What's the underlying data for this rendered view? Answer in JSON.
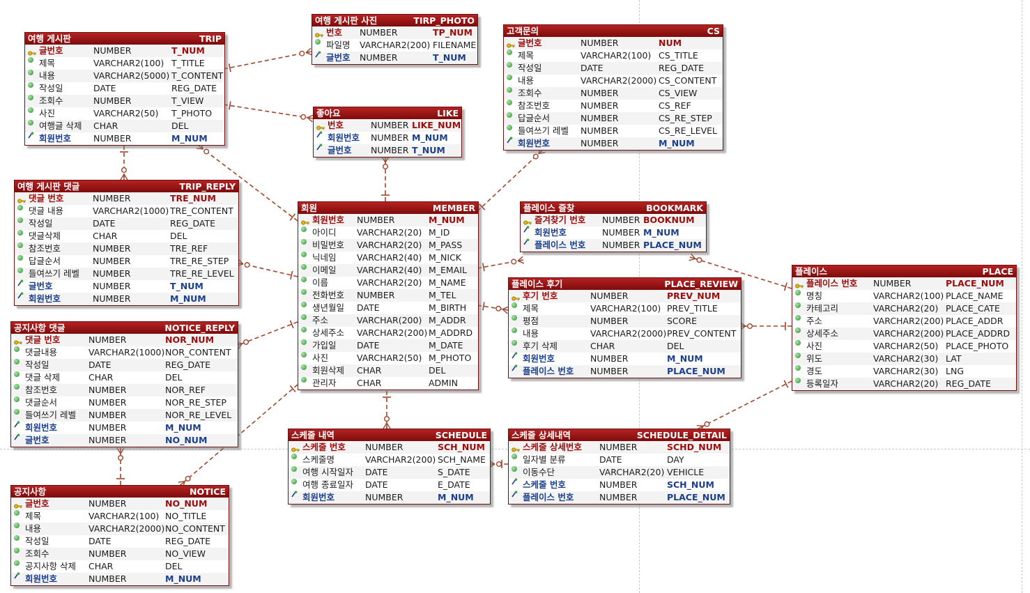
{
  "tables": [
    {
      "id": "trip",
      "title": "여행 게시판",
      "code": "TRIP",
      "rows": [
        {
          "kind": "pk",
          "name": "글번호",
          "type": "NUMBER",
          "col": "T_NUM"
        },
        {
          "kind": "col",
          "name": "제목",
          "type": "VARCHAR2(100)",
          "col": "T_TITLE"
        },
        {
          "kind": "col",
          "name": "내용",
          "type": "VARCHAR2(5000)",
          "col": "T_CONTENT"
        },
        {
          "kind": "col",
          "name": "작성일",
          "type": "DATE",
          "col": "REG_DATE"
        },
        {
          "kind": "col",
          "name": "조회수",
          "type": "NUMBER",
          "col": "T_VIEW"
        },
        {
          "kind": "col",
          "name": "사진",
          "type": "VARCHAR2(50)",
          "col": "T_PHOTO"
        },
        {
          "kind": "col",
          "name": "여행글 삭제",
          "type": "CHAR",
          "col": "DEL"
        },
        {
          "kind": "fk",
          "name": "회원번호",
          "type": "NUMBER",
          "col": "M_NUM"
        }
      ]
    },
    {
      "id": "trip_photo",
      "title": "여행 게시판 사진",
      "code": "TIRP_PHOTO",
      "rows": [
        {
          "kind": "pk",
          "name": "번호",
          "type": "NUMBER",
          "col": "TP_NUM"
        },
        {
          "kind": "col",
          "name": "파일명",
          "type": "VARCHAR2(200)",
          "col": "FILENAME"
        },
        {
          "kind": "fk",
          "name": "글번호",
          "type": "NUMBER",
          "col": "T_NUM"
        }
      ]
    },
    {
      "id": "cs",
      "title": "고객문의",
      "code": "CS",
      "rows": [
        {
          "kind": "pk",
          "name": "글번호",
          "type": "NUMBER",
          "col": "NUM"
        },
        {
          "kind": "col",
          "name": "제목",
          "type": "VARCHAR2(100)",
          "col": "CS_TITLE"
        },
        {
          "kind": "col",
          "name": "작성일",
          "type": "DATE",
          "col": "REG_DATE"
        },
        {
          "kind": "col",
          "name": "내용",
          "type": "VARCHAR2(2000)",
          "col": "CS_CONTENT"
        },
        {
          "kind": "col",
          "name": "조회수",
          "type": "NUMBER",
          "col": "CS_VIEW"
        },
        {
          "kind": "col",
          "name": "참조번호",
          "type": "NUMBER",
          "col": "CS_REF"
        },
        {
          "kind": "col",
          "name": "답글순서",
          "type": "NUMBER",
          "col": "CS_RE_STEP"
        },
        {
          "kind": "col",
          "name": "들여쓰기 레벨",
          "type": "NUMBER",
          "col": "CS_RE_LEVEL"
        },
        {
          "kind": "fk",
          "name": "회원번호",
          "type": "NUMBER",
          "col": "M_NUM"
        }
      ]
    },
    {
      "id": "like",
      "title": "좋아요",
      "code": "LIKE",
      "rows": [
        {
          "kind": "pk",
          "name": "번호",
          "type": "NUMBER",
          "col": "LIKE_NUM"
        },
        {
          "kind": "fk",
          "name": "회원번호",
          "type": "NUMBER",
          "col": "M_NUM"
        },
        {
          "kind": "fk",
          "name": "글번호",
          "type": "NUMBER",
          "col": "T_NUM"
        }
      ]
    },
    {
      "id": "trip_reply",
      "title": "여행 게시판 댓글",
      "code": "TRIP_REPLY",
      "rows": [
        {
          "kind": "pk",
          "name": "댓글 번호",
          "type": "NUMBER",
          "col": "TRE_NUM"
        },
        {
          "kind": "col",
          "name": "댓글 내용",
          "type": "VARCHAR2(1000)",
          "col": "TRE_CONTENT"
        },
        {
          "kind": "col",
          "name": "작성일",
          "type": "DATE",
          "col": "REG_DATE"
        },
        {
          "kind": "col",
          "name": "댓글삭제",
          "type": "CHAR",
          "col": "DEL"
        },
        {
          "kind": "col",
          "name": "참조번호",
          "type": "NUMBER",
          "col": "TRE_REF"
        },
        {
          "kind": "col",
          "name": "답글순서",
          "type": "NUMBER",
          "col": "TRE_RE_STEP"
        },
        {
          "kind": "col",
          "name": "들여쓰기 레벨",
          "type": "NUMBER",
          "col": "TRE_RE_LEVEL"
        },
        {
          "kind": "fk",
          "name": "글번호",
          "type": "NUMBER",
          "col": "T_NUM"
        },
        {
          "kind": "fk",
          "name": "회원번호",
          "type": "NUMBER",
          "col": "M_NUM"
        }
      ]
    },
    {
      "id": "member",
      "title": "회원",
      "code": "MEMBER",
      "rows": [
        {
          "kind": "pk",
          "name": "회원번호",
          "type": "NUMBER",
          "col": "M_NUM"
        },
        {
          "kind": "col",
          "name": "아이디",
          "type": "VARCHAR2(20)",
          "col": "M_ID"
        },
        {
          "kind": "col",
          "name": "비밀번호",
          "type": "VARCHAR2(20)",
          "col": "M_PASS"
        },
        {
          "kind": "col",
          "name": "닉네임",
          "type": "VARCHAR2(40)",
          "col": "M_NICK"
        },
        {
          "kind": "col",
          "name": "이메일",
          "type": "VARCHAR2(40)",
          "col": "M_EMAIL"
        },
        {
          "kind": "col",
          "name": "이름",
          "type": "VARCHAR2(20)",
          "col": "M_NAME"
        },
        {
          "kind": "col",
          "name": "전화번호",
          "type": "NUMBER",
          "col": "M_TEL"
        },
        {
          "kind": "col",
          "name": "생년월일",
          "type": "DATE",
          "col": "M_BIRTH"
        },
        {
          "kind": "col",
          "name": "주소",
          "type": "VARCHAR(200)",
          "col": "M_ADDR"
        },
        {
          "kind": "col",
          "name": "상세주소",
          "type": "VARCHAR2(200)",
          "col": "M_ADDRD"
        },
        {
          "kind": "col",
          "name": "가입일",
          "type": "DATE",
          "col": "M_DATE"
        },
        {
          "kind": "col",
          "name": "사진",
          "type": "VARCHAR2(50)",
          "col": "M_PHOTO"
        },
        {
          "kind": "col",
          "name": "회원삭제",
          "type": "CHAR",
          "col": "DEL"
        },
        {
          "kind": "col",
          "name": "관리자",
          "type": "CHAR",
          "col": "ADMIN"
        }
      ]
    },
    {
      "id": "bookmark",
      "title": "플레이스 즐찾",
      "code": "BOOKMARK",
      "rows": [
        {
          "kind": "pk",
          "name": "즐겨찾기 번호",
          "type": "NUMBER",
          "col": "BOOKNUM"
        },
        {
          "kind": "fk",
          "name": "회원번호",
          "type": "NUMBER",
          "col": "M_NUM"
        },
        {
          "kind": "fk",
          "name": "플레이스 번호",
          "type": "NUMBER",
          "col": "PLACE_NUM"
        }
      ]
    },
    {
      "id": "place",
      "title": "플레이스",
      "code": "PLACE",
      "rows": [
        {
          "kind": "pk",
          "name": "플레이스 번호",
          "type": "NUMBER",
          "col": "PLACE_NUM"
        },
        {
          "kind": "col",
          "name": "명칭",
          "type": "VARCHAR2(100)",
          "col": "PLACE_NAME"
        },
        {
          "kind": "col",
          "name": "카테고리",
          "type": "VARCHAR2(20)",
          "col": "PLACE_CATE"
        },
        {
          "kind": "col",
          "name": "주소",
          "type": "VARCHAR2(200)",
          "col": "PLACE_ADDR"
        },
        {
          "kind": "col",
          "name": "상세주소",
          "type": "VARCHAR2(200)",
          "col": "PLACE_ADDRD"
        },
        {
          "kind": "col",
          "name": "사진",
          "type": "VARCHAR2(50)",
          "col": "PLACE_PHOTO"
        },
        {
          "kind": "col",
          "name": "위도",
          "type": "VARCHAR2(30)",
          "col": "LAT"
        },
        {
          "kind": "col",
          "name": "경도",
          "type": "VARCHAR2(30)",
          "col": "LNG"
        },
        {
          "kind": "col",
          "name": "등록일자",
          "type": "VARCHAR2(20)",
          "col": "REG_DATE"
        }
      ]
    },
    {
      "id": "place_review",
      "title": "플레이스 후기",
      "code": "PLACE_REVIEW",
      "rows": [
        {
          "kind": "pk",
          "name": "후기 번호",
          "type": "NUMBER",
          "col": "PREV_NUM"
        },
        {
          "kind": "col",
          "name": "제목",
          "type": "VARCHAR2(100)",
          "col": "PREV_TITLE"
        },
        {
          "kind": "col",
          "name": "평점",
          "type": "NUMBER",
          "col": "SCORE"
        },
        {
          "kind": "col",
          "name": "내용",
          "type": "VARCHAR2(2000)",
          "col": "PREV_CONTENT"
        },
        {
          "kind": "col",
          "name": "후기 삭제",
          "type": "CHAR",
          "col": "DEL"
        },
        {
          "kind": "fk",
          "name": "회원번호",
          "type": "NUMBER",
          "col": "M_NUM"
        },
        {
          "kind": "fk",
          "name": "플레이스 번호",
          "type": "NUMBER",
          "col": "PLACE_NUM"
        }
      ]
    },
    {
      "id": "notice_reply",
      "title": "공지사항 댓글",
      "code": "NOTICE_REPLY",
      "rows": [
        {
          "kind": "pk",
          "name": "댓글 번호",
          "type": "NUMBER",
          "col": "NOR_NUM"
        },
        {
          "kind": "col",
          "name": "댓글내용",
          "type": "VARCHAR2(1000)",
          "col": "NOR_CONTENT"
        },
        {
          "kind": "col",
          "name": "작성일",
          "type": "DATE",
          "col": "REG_DATE"
        },
        {
          "kind": "col",
          "name": "댓글 삭제",
          "type": "CHAR",
          "col": "DEL"
        },
        {
          "kind": "col",
          "name": "참조번호",
          "type": "NUMBER",
          "col": "NOR_REF"
        },
        {
          "kind": "col",
          "name": "댓글순서",
          "type": "NUMBER",
          "col": "NOR_RE_STEP"
        },
        {
          "kind": "col",
          "name": "들여쓰기 레벨",
          "type": "NUMBER",
          "col": "NOR_RE_LEVEL"
        },
        {
          "kind": "fk",
          "name": "회원번호",
          "type": "NUMBER",
          "col": "M_NUM"
        },
        {
          "kind": "fk",
          "name": "글번호",
          "type": "NUMBER",
          "col": "NO_NUM"
        }
      ]
    },
    {
      "id": "schedule",
      "title": "스케줄 내역",
      "code": "SCHEDULE",
      "rows": [
        {
          "kind": "pk",
          "name": "스케줄 번호",
          "type": "NUMBER",
          "col": "SCH_NUM"
        },
        {
          "kind": "col",
          "name": "스케줄명",
          "type": "VARCHAR2(200)",
          "col": "SCH_NAME"
        },
        {
          "kind": "col",
          "name": "여행 시작일자",
          "type": "DATE",
          "col": "S_DATE"
        },
        {
          "kind": "col",
          "name": "여행 종료일자",
          "type": "DATE",
          "col": "E_DATE"
        },
        {
          "kind": "fk",
          "name": "회원번호",
          "type": "NUMBER",
          "col": "M_NUM"
        }
      ]
    },
    {
      "id": "schedule_detail",
      "title": "스케줄 상세내역",
      "code": "SCHEDULE_DETAIL",
      "rows": [
        {
          "kind": "pk",
          "name": "스케줄 상세번호",
          "type": "NUMBER",
          "col": "SCHD_NUM"
        },
        {
          "kind": "col",
          "name": "일자별 분류",
          "type": "DATE",
          "col": "DAY"
        },
        {
          "kind": "col",
          "name": "이동수단",
          "type": "VARCHAR2(20)",
          "col": "VEHICLE"
        },
        {
          "kind": "fk",
          "name": "스케줄 번호",
          "type": "NUMBER",
          "col": "SCH_NUM"
        },
        {
          "kind": "fk",
          "name": "플레이스 번호",
          "type": "NUMBER",
          "col": "PLACE_NUM"
        }
      ]
    },
    {
      "id": "notice",
      "title": "공지사항",
      "code": "NOTICE",
      "rows": [
        {
          "kind": "pk",
          "name": "글번호",
          "type": "NUMBER",
          "col": "NO_NUM"
        },
        {
          "kind": "col",
          "name": "제목",
          "type": "VARCHAR2(100)",
          "col": "NO_TITLE"
        },
        {
          "kind": "col",
          "name": "내용",
          "type": "VARCHAR2(2000)",
          "col": "NO_CONTENT"
        },
        {
          "kind": "col",
          "name": "작성일",
          "type": "DATE",
          "col": "REG_DATE"
        },
        {
          "kind": "col",
          "name": "조회수",
          "type": "NUMBER",
          "col": "NO_VIEW"
        },
        {
          "kind": "col",
          "name": "공지사항 삭제",
          "type": "CHAR",
          "col": "DEL"
        },
        {
          "kind": "fk",
          "name": "회원번호",
          "type": "NUMBER",
          "col": "M_NUM"
        }
      ]
    }
  ],
  "relationships": [
    {
      "parent": "trip",
      "child": "trip_photo"
    },
    {
      "parent": "trip",
      "child": "like"
    },
    {
      "parent": "trip",
      "child": "trip_reply"
    },
    {
      "parent": "member",
      "child": "trip"
    },
    {
      "parent": "member",
      "child": "like"
    },
    {
      "parent": "member",
      "child": "cs"
    },
    {
      "parent": "member",
      "child": "trip_reply"
    },
    {
      "parent": "member",
      "child": "notice_reply"
    },
    {
      "parent": "member",
      "child": "notice"
    },
    {
      "parent": "member",
      "child": "bookmark"
    },
    {
      "parent": "member",
      "child": "place_review"
    },
    {
      "parent": "member",
      "child": "schedule"
    },
    {
      "parent": "place",
      "child": "bookmark"
    },
    {
      "parent": "place",
      "child": "place_review"
    },
    {
      "parent": "place",
      "child": "schedule_detail"
    },
    {
      "parent": "schedule",
      "child": "schedule_detail"
    },
    {
      "parent": "notice",
      "child": "notice_reply"
    }
  ],
  "colors": {
    "header": "#9b1515",
    "pk_text": "#9b0d0d",
    "fk_text": "#1c3f8c",
    "line": "#a0442a"
  }
}
